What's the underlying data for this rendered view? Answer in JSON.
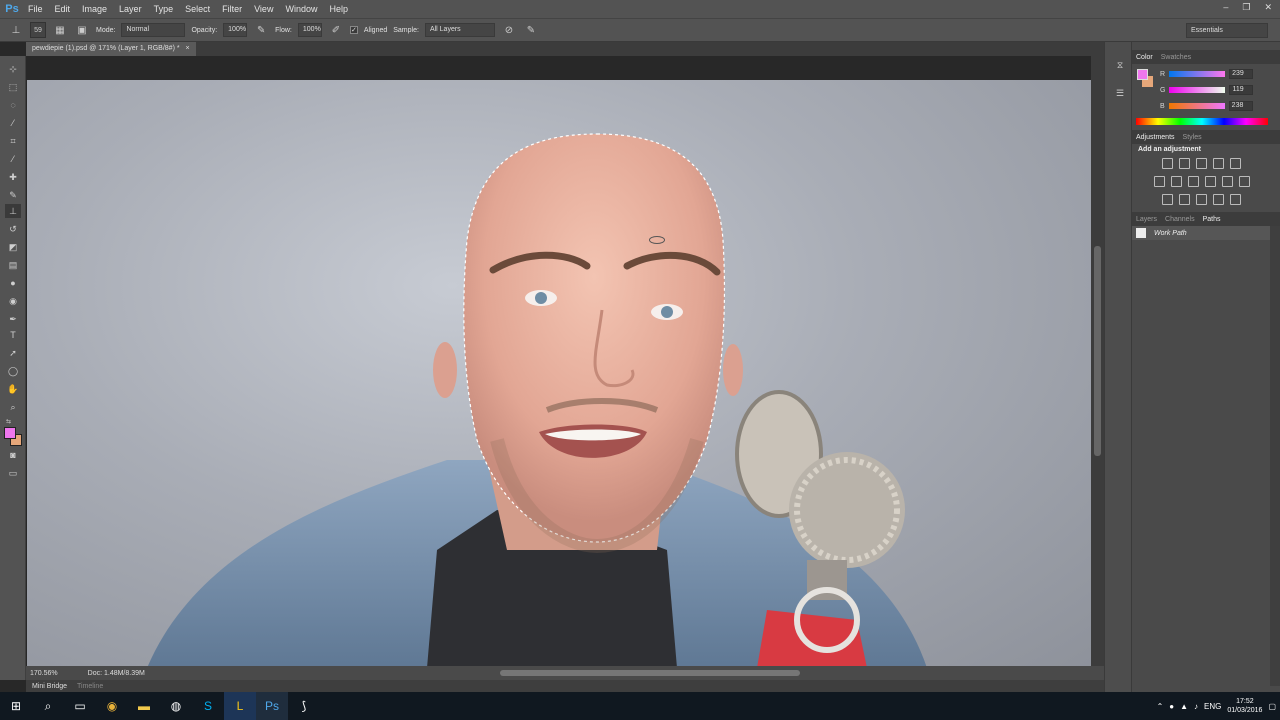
{
  "app": {
    "logo": "Ps"
  },
  "menu": [
    "File",
    "Edit",
    "Image",
    "Layer",
    "Type",
    "Select",
    "Filter",
    "View",
    "Window",
    "Help"
  ],
  "window_controls": {
    "minimize": "–",
    "restore": "❐",
    "close": "✕"
  },
  "options": {
    "mode_label": "Mode:",
    "mode_value": "Normal",
    "opacity_label": "Opacity:",
    "opacity_value": "100%",
    "flow_label": "Flow:",
    "flow_value": "100%",
    "aligned_label": "Aligned",
    "sample_label": "Sample:",
    "sample_value": "All Layers",
    "brush_size": "59",
    "workspace": "Essentials"
  },
  "document": {
    "tab_title": "pewdiepie (1).psd @ 171% (Layer 1, RGB/8#) *"
  },
  "status": {
    "zoom": "170.56%",
    "doc_size": "Doc: 1.48M/8.39M"
  },
  "bridge": {
    "tabs": [
      "Mini Bridge",
      "Timeline"
    ]
  },
  "color_panel": {
    "tabs": [
      "Color",
      "Swatches"
    ],
    "fg_color": "#ef77ee",
    "bg_color": "#e6a77a",
    "channels": [
      {
        "label": "R",
        "value": "239"
      },
      {
        "label": "G",
        "value": "119"
      },
      {
        "label": "B",
        "value": "238"
      }
    ]
  },
  "adjustments_panel": {
    "tabs": [
      "Adjustments",
      "Styles"
    ],
    "heading": "Add an adjustment"
  },
  "layers_panel": {
    "tabs": [
      "Layers",
      "Channels",
      "Paths"
    ],
    "path_item": "Work Path"
  },
  "taskbar": {
    "lang": "ENG",
    "time": "17:52",
    "date": "01/03/2016"
  }
}
